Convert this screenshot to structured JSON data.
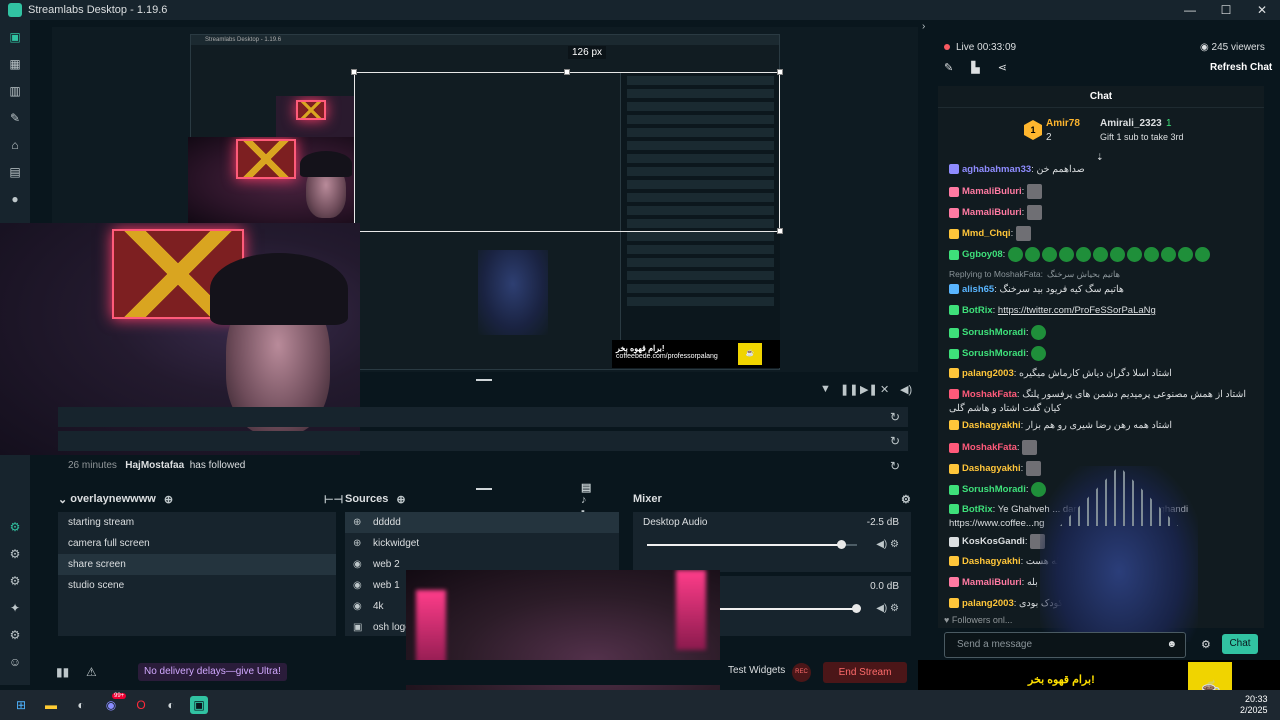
{
  "window": {
    "title": "Streamlabs Desktop - 1.19.6",
    "controls": [
      "—",
      "☐",
      "✕"
    ]
  },
  "sidebar": {
    "top_icons": [
      "studio-icon",
      "dashboard-icon",
      "layout-icon",
      "themes-icon",
      "store-icon",
      "media-icon",
      "play-icon"
    ],
    "bottom_icons": [
      "app-icon",
      "widget-icon",
      "settings-2-icon",
      "tools-icon",
      "settings-icon",
      "user-icon"
    ]
  },
  "preview": {
    "size_label": "126 px",
    "inner_title": "Streamlabs Desktop - 1.19.6"
  },
  "activity": [
    {
      "text": ""
    },
    {
      "text": ""
    },
    {
      "time": "26 minutes",
      "user": "HajMostafaa",
      "action": "has followed"
    }
  ],
  "scenes": {
    "title": "overlaynewwww",
    "items": [
      "starting stream",
      "camera full screen",
      "share screen",
      "studio scene"
    ],
    "selected": 2
  },
  "sources": {
    "title": "Sources",
    "items": [
      {
        "icon": "globe-icon",
        "label": "ddddd"
      },
      {
        "icon": "globe-icon",
        "label": "kickwidget"
      },
      {
        "icon": "webcam-icon",
        "label": "web 2"
      },
      {
        "icon": "webcam-icon",
        "label": "web 1"
      },
      {
        "icon": "webcam-icon",
        "label": "4k"
      },
      {
        "icon": "image-icon",
        "label": "osh logo"
      }
    ],
    "selected": 0
  },
  "mixer": {
    "title": "Mixer",
    "channels": [
      {
        "name": "Desktop Audio",
        "db": "-2.5 dB",
        "level": 0.93
      },
      {
        "name": "",
        "db": "0.0 dB",
        "level": 1.0
      }
    ]
  },
  "status": {
    "promo": "No delivery delays—give Ultra!",
    "test_widgets": "Test Widgets",
    "rec": "REC",
    "end_stream": "End Stream"
  },
  "live": {
    "label": "Live",
    "time": "00:33:09",
    "viewers": "245 viewers",
    "refresh": "Refresh Chat"
  },
  "chat": {
    "title": "Chat",
    "goal": {
      "rank": "1",
      "name1": "Amir78",
      "count1": "2",
      "name2": "Amirali_2323",
      "count2": "1",
      "gift": "Gift 1 sub to take 3rd"
    },
    "messages": [
      {
        "user": "aghabahman33",
        "color": "#8f8cff",
        "text": "صداهمم خن"
      },
      {
        "user": "MamaliBuluri",
        "color": "#ff7aa2",
        "text": "",
        "emotes": 1,
        "pic": true
      },
      {
        "user": "MamaliBuluri",
        "color": "#ff7aa2",
        "text": "",
        "emotes": 1,
        "pic": true
      },
      {
        "user": "Mmd_Chqi",
        "color": "#ffc63a",
        "text": "",
        "emotes": 1,
        "pic": true
      },
      {
        "user": "Ggboy08",
        "color": "#3ee07a",
        "text": "",
        "emotes": 12
      },
      {
        "reply": "Replying to MoshakFata:",
        "reply_text": "هاتیم بحیاش سرخنگ"
      },
      {
        "user": "alish65",
        "color": "#59b5ff",
        "text": "هاتیم سگ کیه فریود بید سرخنگ"
      },
      {
        "user": "BotRix",
        "color": "#3ee07a",
        "text": "https://twitter.com/ProFeSSorPaLaNg",
        "link": true
      },
      {
        "user": "SorushMoradi",
        "color": "#3ee07a",
        "text": "",
        "emotes": 1
      },
      {
        "user": "SorushMoradi",
        "color": "#3ee07a",
        "text": "",
        "emotes": 1
      },
      {
        "user": "palang2003",
        "color": "#ffc63a",
        "text": "اشتاد اسلا دگران دیاش کارماش میگیره"
      },
      {
        "user": "MoshakFata",
        "color": "#ff5a7a",
        "text": "اشتاد از همش مصنوعی پرمیدیم دشمن های پرفسور پلنگ کیان گفت اشتاد و هاشم گلی"
      },
      {
        "user": "Dashagyakhi",
        "color": "#ffc63a",
        "text": "اشتاد همه رهن رضا شیری رو هم بزار"
      },
      {
        "user": "MoshakFata",
        "color": "#ff5a7a",
        "text": "",
        "emotes": 1,
        "pic": true
      },
      {
        "user": "Dashagyakhi",
        "color": "#ffc63a",
        "text": "",
        "emotes": 1,
        "pic": true
      },
      {
        "user": "SorushMoradi",
        "color": "#3ee07a",
        "text": "",
        "emotes": 1
      },
      {
        "user": "BotRix",
        "color": "#3ee07a",
        "text": "Ye Ghahveh ... dar ghahve boos boos ghandi https://www.coffee...ng"
      },
      {
        "user": "KosKosGandi",
        "color": "#dcdfe1",
        "text": "",
        "emotes": 1,
        "pic": true
      },
      {
        "user": "Dashagyakhi",
        "color": "#ffc63a",
        "text": "بله هست"
      },
      {
        "user": "MamaliBuluri",
        "color": "#ff7aa2",
        "text": "بله"
      },
      {
        "user": "palang2003",
        "color": "#ffc63a",
        "text": "دی کودک بودی"
      }
    ],
    "followers_only": "Followers onl...",
    "input_placeholder": "Send a message",
    "send": "Chat"
  },
  "banner": {
    "line1": "برام قهوه بخر!",
    "line2": "coffeebede.com/professorpalang"
  },
  "taskbar": {
    "time": "20:33",
    "date": "2/2025",
    "apps": [
      "windows-icon",
      "files-icon",
      "steam-icon",
      "discord-icon",
      "opera-icon",
      "steam-2-icon",
      "streamlabs-icon"
    ],
    "badge": "99+"
  }
}
